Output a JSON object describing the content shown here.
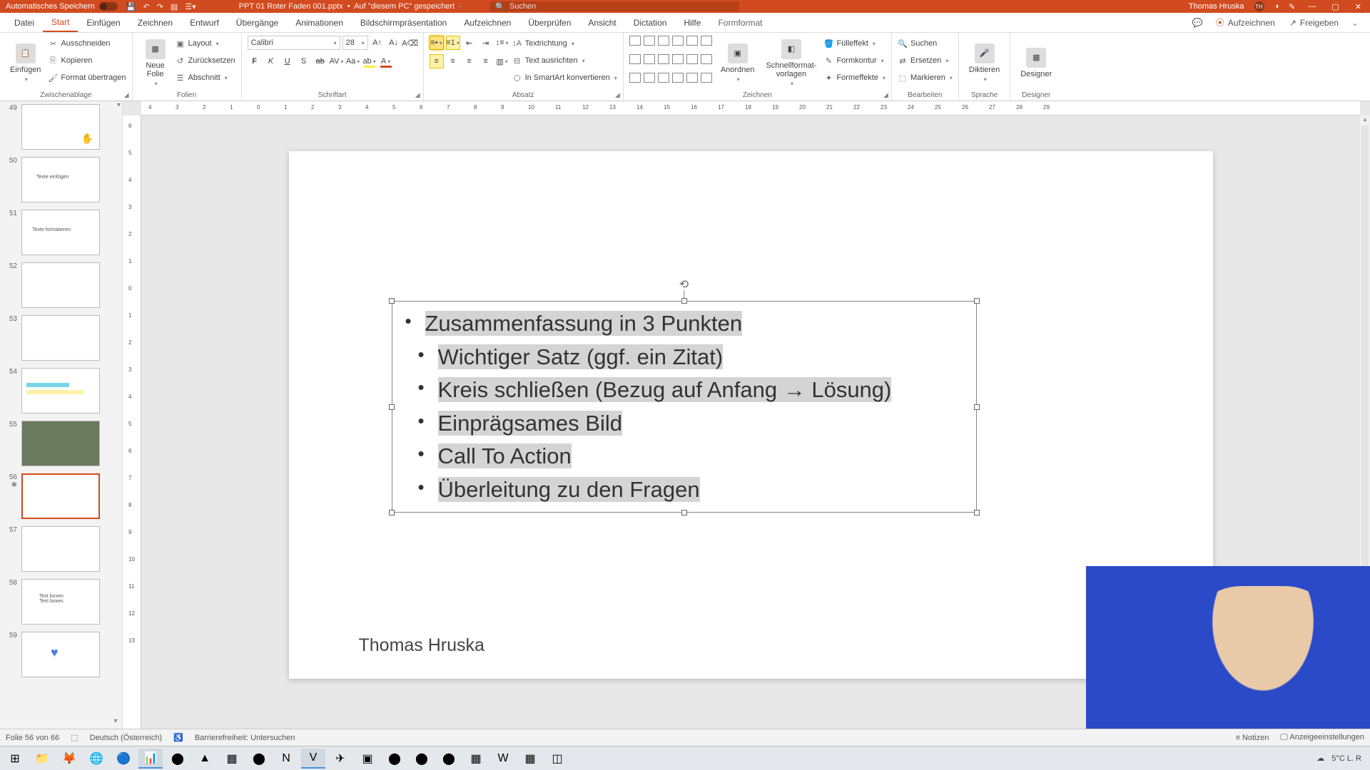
{
  "titlebar": {
    "autosave": "Automatisches Speichern",
    "docname": "PPT 01 Roter Faden 001.pptx",
    "savedloc": "Auf \"diesem PC\" gespeichert",
    "search_placeholder": "Suchen",
    "username": "Thomas Hruska",
    "initials": "TH"
  },
  "tabs": {
    "items": [
      "Datei",
      "Start",
      "Einfügen",
      "Zeichnen",
      "Entwurf",
      "Übergänge",
      "Animationen",
      "Bildschirmpräsentation",
      "Aufzeichnen",
      "Überprüfen",
      "Ansicht",
      "Dictation",
      "Hilfe",
      "Formformat"
    ],
    "active": 1,
    "record": "Aufzeichnen",
    "share": "Freigeben"
  },
  "ribbon": {
    "clipboard": {
      "paste": "Einfügen",
      "cut": "Ausschneiden",
      "copy": "Kopieren",
      "formatpainter": "Format übertragen",
      "label": "Zwischenablage"
    },
    "slides": {
      "newslide": "Neue\nFolie",
      "layout": "Layout",
      "reset": "Zurücksetzen",
      "section": "Abschnitt",
      "label": "Folien"
    },
    "font": {
      "name": "Calibri",
      "size": "28",
      "label": "Schriftart"
    },
    "paragraph": {
      "textdir": "Textrichtung",
      "aligntext": "Text ausrichten",
      "smartart": "In SmartArt konvertieren",
      "label": "Absatz"
    },
    "drawing": {
      "arrange": "Anordnen",
      "quickstyles": "Schnellformat-\nvorlagen",
      "fill": "Fülleffekt",
      "outline": "Formkontur",
      "effects": "Formeffekte",
      "label": "Zeichnen"
    },
    "editing": {
      "find": "Suchen",
      "replace": "Ersetzen",
      "select": "Markieren",
      "label": "Bearbeiten"
    },
    "voice": {
      "dictate": "Diktieren",
      "label": "Sprache"
    },
    "designer": {
      "btn": "Designer",
      "label": "Designer"
    }
  },
  "thumbnails": [
    {
      "n": "49",
      "txt": ""
    },
    {
      "n": "50",
      "txt": "Texte einfügen"
    },
    {
      "n": "51",
      "txt": "Texte formatieren"
    },
    {
      "n": "52",
      "txt": ""
    },
    {
      "n": "53",
      "txt": ""
    },
    {
      "n": "54",
      "txt": ""
    },
    {
      "n": "55",
      "txt": ""
    },
    {
      "n": "56",
      "txt": "",
      "selected": true
    },
    {
      "n": "57",
      "txt": ""
    },
    {
      "n": "58",
      "txt": "Text boxen\nText boxes"
    },
    {
      "n": "59",
      "txt": ""
    }
  ],
  "slide": {
    "bullets": [
      "Zusammenfassung in 3 Punkten",
      "Wichtiger Satz (ggf. ein Zitat)",
      "Kreis schließen (Bezug auf Anfang → Lösung)",
      "Einprägsames Bild",
      "Call To Action",
      "Überleitung zu den Fragen"
    ],
    "author": "Thomas Hruska"
  },
  "statusbar": {
    "slideinfo": "Folie 56 von 66",
    "lang": "Deutsch (Österreich)",
    "accessibility": "Barrierefreiheit: Untersuchen",
    "notes": "Notizen",
    "display": "Anzeigeeinstellungen"
  },
  "taskbar": {
    "weather": "5°C  L. R"
  },
  "ruler": {
    "h": [
      "4",
      "3",
      "2",
      "1",
      "0",
      "1",
      "2",
      "3",
      "4",
      "5",
      "6",
      "7",
      "8",
      "9",
      "10",
      "11",
      "12",
      "13",
      "14",
      "15",
      "16",
      "17",
      "18",
      "19",
      "20",
      "21",
      "22",
      "23",
      "24",
      "25",
      "26",
      "27",
      "28",
      "29"
    ],
    "v": [
      "6",
      "5",
      "4",
      "3",
      "2",
      "1",
      "0",
      "1",
      "2",
      "3",
      "4",
      "5",
      "6",
      "7",
      "8",
      "9",
      "10",
      "11",
      "12",
      "13"
    ]
  }
}
